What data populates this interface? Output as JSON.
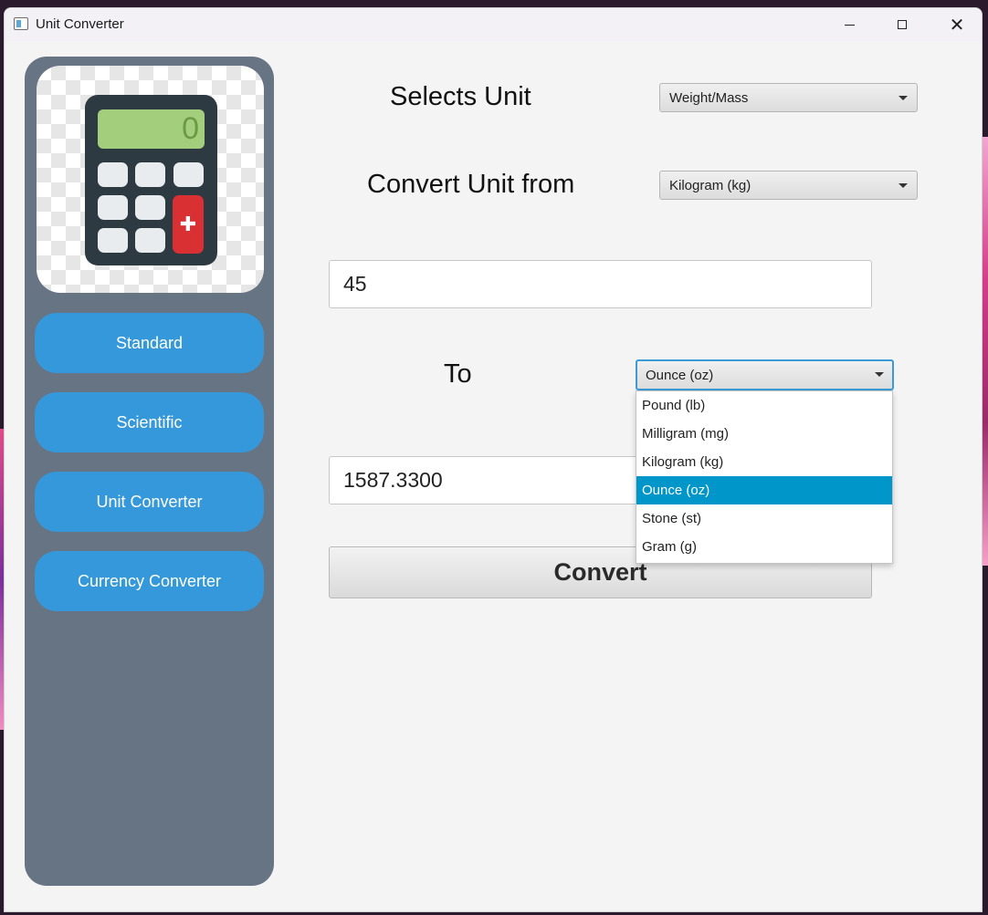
{
  "window": {
    "title": "Unit Converter"
  },
  "sidebar": {
    "calculator_display": "0",
    "items": [
      {
        "label": "Standard"
      },
      {
        "label": "Scientific"
      },
      {
        "label": "Unit Converter"
      },
      {
        "label": "Currency Converter"
      }
    ]
  },
  "main": {
    "select_unit_label": "Selects Unit",
    "unit_type": "Weight/Mass",
    "from_label": "Convert Unit from",
    "from_unit": "Kilogram (kg)",
    "input_value": "45",
    "to_label": "To",
    "to_unit": "Ounce (oz)",
    "result_value": "1587.3300",
    "convert_label": "Convert",
    "to_unit_options": [
      {
        "label": "Pound (lb)"
      },
      {
        "label": "Milligram (mg)"
      },
      {
        "label": "Kilogram (kg)"
      },
      {
        "label": "Ounce (oz)"
      },
      {
        "label": "Stone (st)"
      },
      {
        "label": "Gram (g)"
      }
    ],
    "selected_option_index": 3
  },
  "colors": {
    "sidebar_bg": "#677483",
    "nav_button": "#3498db",
    "selection": "#0096c9",
    "focus_border": "#3c9bd6"
  }
}
